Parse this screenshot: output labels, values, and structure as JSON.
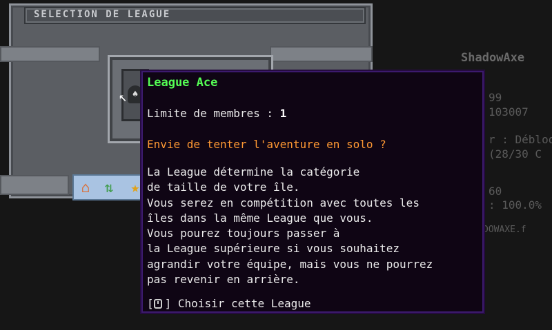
{
  "scoreboard": {
    "title": "ShadowAxe",
    "lines": [
      "99",
      "103007",
      "",
      "r : Débloq",
      "(28/30 C",
      "",
      "60",
      ": 100.0%",
      "DOWAXE.f"
    ]
  },
  "gui": {
    "title": "SELECTION DE LEAGUE",
    "slot_icon": "league-ace-icon",
    "icon_bar": {
      "home_icon": "home-icon",
      "island_icon": "island-icon",
      "trophy_icon": "trophy-icon"
    }
  },
  "tooltip": {
    "title": "League Ace",
    "member_limit_label": "Limite de membres : ",
    "member_limit_value": "1",
    "tagline": "Envie de tenter l'aventure en solo ?",
    "description": "La League détermine la catégorie\nde taille de votre île.\nVous serez en compétition avec toutes les\nîles dans la même League que vous.\nVous pourez toujours passer à\nla League supérieure si vous souhaitez\nagrandir votre équipe, mais vous ne pourrez\npas revenir en arrière.",
    "action": "Choisir cette League"
  },
  "colors": {
    "tooltip_bg": "#0f0514",
    "tooltip_border": "#3c1a6e",
    "title_green": "#55ff55",
    "tagline_orange": "#ff9933"
  }
}
